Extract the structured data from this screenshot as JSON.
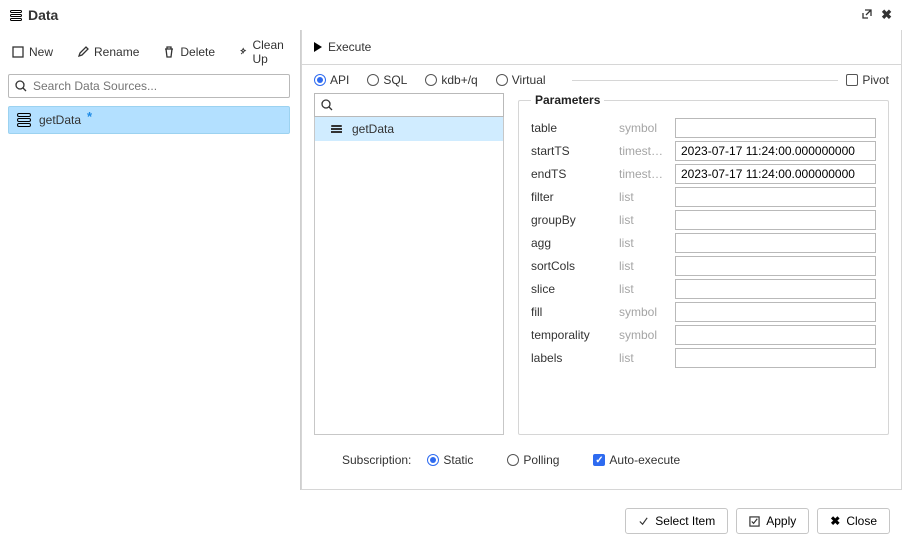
{
  "header": {
    "title": "Data"
  },
  "left": {
    "toolbar": {
      "new": "New",
      "rename": "Rename",
      "delete": "Delete",
      "clean": "Clean Up"
    },
    "search_placeholder": "Search Data Sources...",
    "datasources": [
      {
        "name": "getData",
        "modified": true
      }
    ]
  },
  "right": {
    "execute": "Execute",
    "modes": {
      "selected": "API",
      "options": [
        "API",
        "SQL",
        "kdb+/q",
        "Virtual"
      ]
    },
    "pivot_label": "Pivot",
    "api_list": {
      "items": [
        "getData"
      ]
    },
    "parameters": {
      "legend": "Parameters",
      "rows": [
        {
          "name": "table",
          "type": "symbol",
          "value": ""
        },
        {
          "name": "startTS",
          "type": "timestamp",
          "value": "2023-07-17 11:24:00.000000000"
        },
        {
          "name": "endTS",
          "type": "timestamp",
          "value": "2023-07-17 11:24:00.000000000"
        },
        {
          "name": "filter",
          "type": "list",
          "value": ""
        },
        {
          "name": "groupBy",
          "type": "list",
          "value": ""
        },
        {
          "name": "agg",
          "type": "list",
          "value": ""
        },
        {
          "name": "sortCols",
          "type": "list",
          "value": ""
        },
        {
          "name": "slice",
          "type": "list",
          "value": ""
        },
        {
          "name": "fill",
          "type": "symbol",
          "value": ""
        },
        {
          "name": "temporality",
          "type": "symbol",
          "value": ""
        },
        {
          "name": "labels",
          "type": "list",
          "value": ""
        }
      ]
    },
    "subscription": {
      "label": "Subscription:",
      "mode": "Static",
      "modes": [
        "Static",
        "Polling"
      ],
      "autoexec_label": "Auto-execute",
      "autoexec": true
    }
  },
  "footer": {
    "select": "Select Item",
    "apply": "Apply",
    "close": "Close"
  }
}
